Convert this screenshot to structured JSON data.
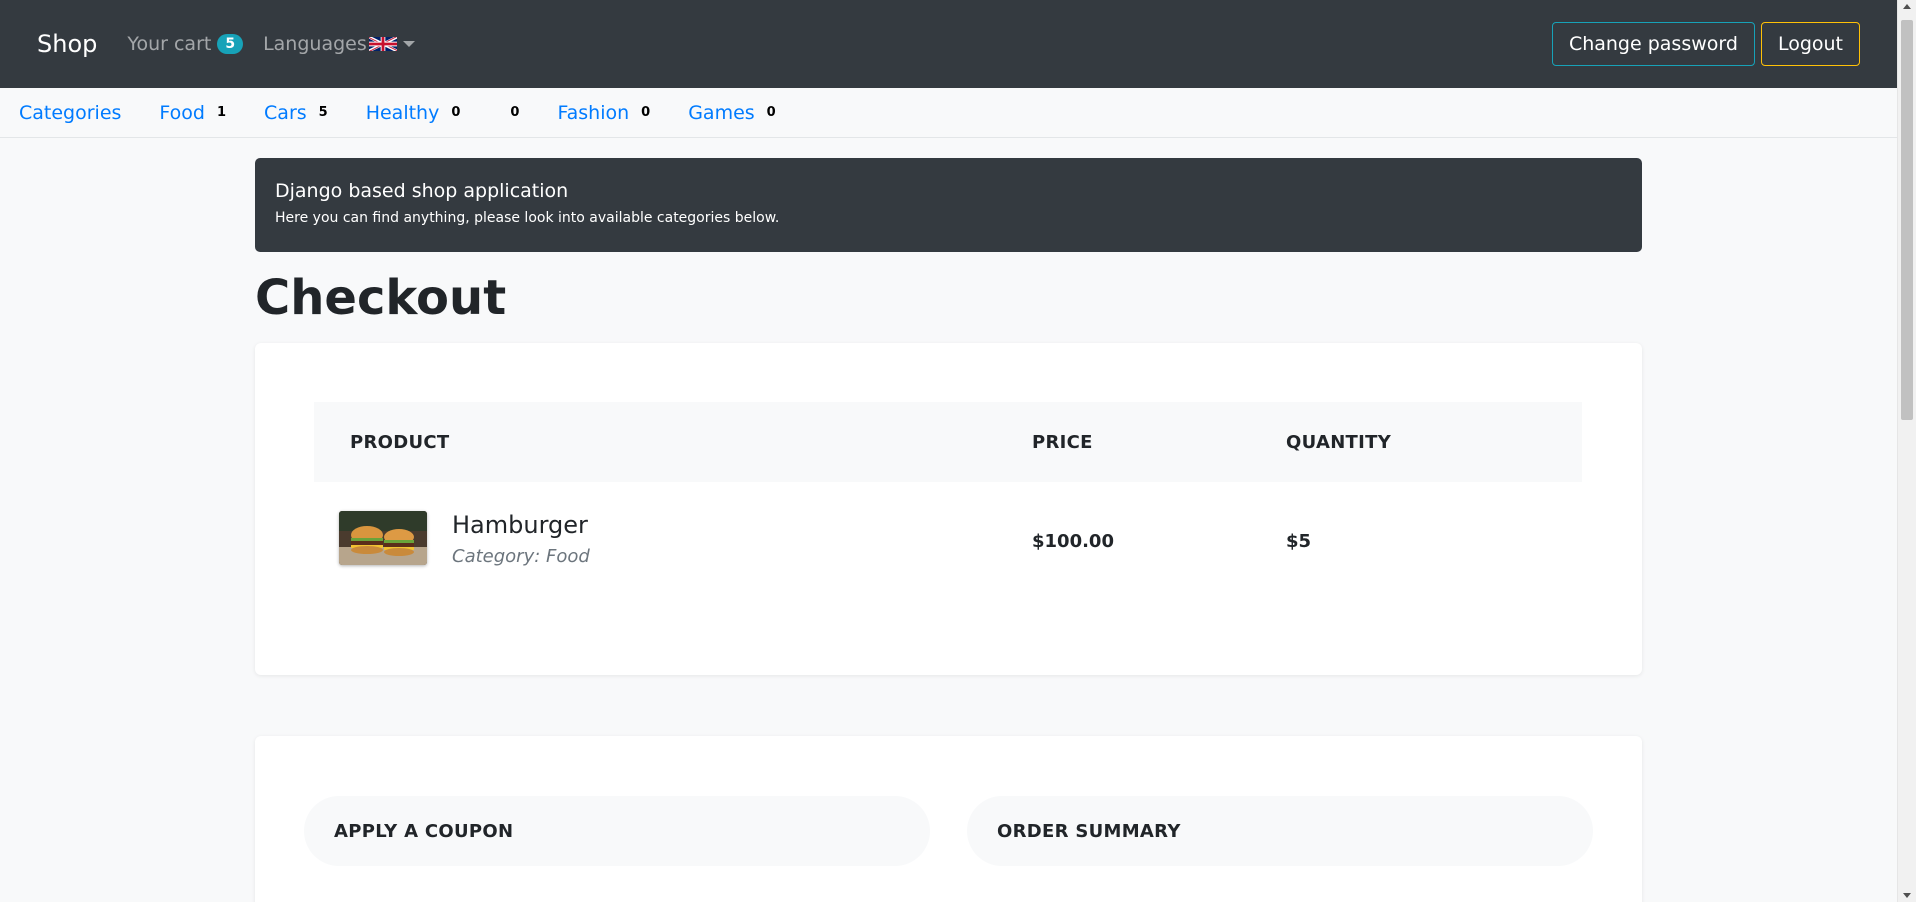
{
  "navbar": {
    "brand": "Shop",
    "cart_label": "Your cart",
    "cart_count": "5",
    "languages_label": "Languages",
    "flag_icon": "uk-flag-icon",
    "change_password_label": "Change password",
    "logout_label": "Logout"
  },
  "categories_bar": {
    "items": [
      {
        "label": "Categories",
        "count": ""
      },
      {
        "label": "Food",
        "count": "1"
      },
      {
        "label": "Cars",
        "count": "5"
      },
      {
        "label": "Healthy",
        "count": "0"
      },
      {
        "label": "",
        "count": "0"
      },
      {
        "label": "Fashion",
        "count": "0"
      },
      {
        "label": "Games",
        "count": "0"
      }
    ]
  },
  "hero": {
    "title": "Django based shop application",
    "subtitle": "Here you can find anything, please look into available categories below."
  },
  "page_title": "Checkout",
  "cart_table": {
    "headers": {
      "product": "PRODUCT",
      "price": "PRICE",
      "quantity": "QUANTITY"
    },
    "rows": [
      {
        "name": "Hamburger",
        "category": "Category: Food",
        "price": "$100.00",
        "quantity": "$5"
      }
    ]
  },
  "summary": {
    "coupon_label": "APPLY A COUPON",
    "order_summary_label": "ORDER SUMMARY"
  },
  "colors": {
    "navbar_bg": "#343a40",
    "link": "#007bff",
    "badge": "#17a2b8",
    "warning": "#ffc107"
  }
}
